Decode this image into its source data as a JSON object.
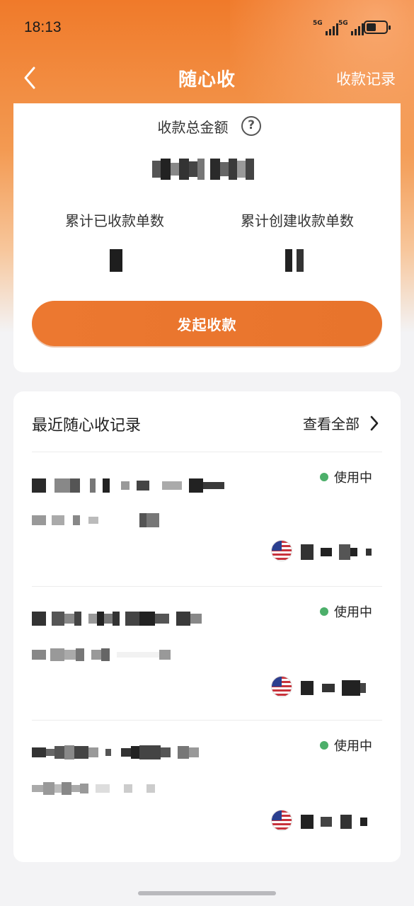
{
  "status_bar": {
    "time": "18:13",
    "network_1": "5G",
    "network_2": "5G"
  },
  "nav": {
    "title": "随心收",
    "right_link": "收款记录"
  },
  "summary": {
    "total_label": "收款总金额",
    "help_glyph": "?",
    "collected_label": "累计已收款单数",
    "created_label": "累计创建收款单数",
    "cta_label": "发起收款"
  },
  "records": {
    "title": "最近随心收记录",
    "view_all": "查看全部",
    "items": [
      {
        "status": "使用中",
        "status_color": "#4caf6a",
        "flag": "us-flag"
      },
      {
        "status": "使用中",
        "status_color": "#4caf6a",
        "flag": "us-flag"
      },
      {
        "status": "使用中",
        "status_color": "#4caf6a",
        "flag": "us-flag"
      }
    ]
  },
  "colors": {
    "accent": "#ec7830",
    "nav_text": "#ffffff",
    "status_active": "#4caf6a"
  }
}
